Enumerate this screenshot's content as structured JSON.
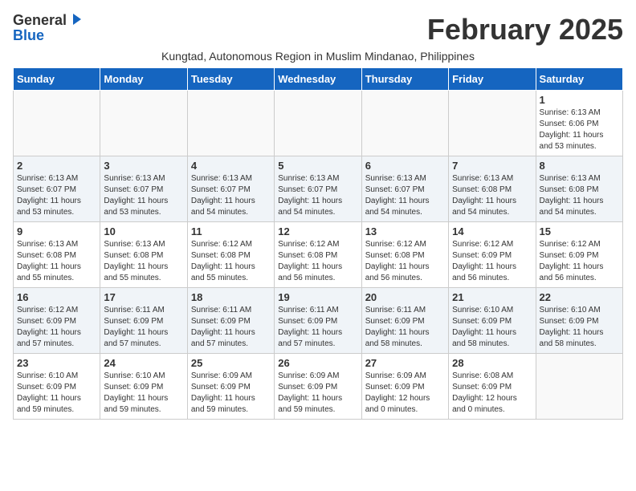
{
  "header": {
    "logo_top": "General",
    "logo_bottom": "Blue",
    "month": "February 2025",
    "location": "Kungtad, Autonomous Region in Muslim Mindanao, Philippines"
  },
  "weekdays": [
    "Sunday",
    "Monday",
    "Tuesday",
    "Wednesday",
    "Thursday",
    "Friday",
    "Saturday"
  ],
  "weeks": [
    {
      "shaded": false,
      "days": [
        {
          "num": "",
          "info": ""
        },
        {
          "num": "",
          "info": ""
        },
        {
          "num": "",
          "info": ""
        },
        {
          "num": "",
          "info": ""
        },
        {
          "num": "",
          "info": ""
        },
        {
          "num": "",
          "info": ""
        },
        {
          "num": "1",
          "info": "Sunrise: 6:13 AM\nSunset: 6:06 PM\nDaylight: 11 hours\nand 53 minutes."
        }
      ]
    },
    {
      "shaded": true,
      "days": [
        {
          "num": "2",
          "info": "Sunrise: 6:13 AM\nSunset: 6:07 PM\nDaylight: 11 hours\nand 53 minutes."
        },
        {
          "num": "3",
          "info": "Sunrise: 6:13 AM\nSunset: 6:07 PM\nDaylight: 11 hours\nand 53 minutes."
        },
        {
          "num": "4",
          "info": "Sunrise: 6:13 AM\nSunset: 6:07 PM\nDaylight: 11 hours\nand 54 minutes."
        },
        {
          "num": "5",
          "info": "Sunrise: 6:13 AM\nSunset: 6:07 PM\nDaylight: 11 hours\nand 54 minutes."
        },
        {
          "num": "6",
          "info": "Sunrise: 6:13 AM\nSunset: 6:07 PM\nDaylight: 11 hours\nand 54 minutes."
        },
        {
          "num": "7",
          "info": "Sunrise: 6:13 AM\nSunset: 6:08 PM\nDaylight: 11 hours\nand 54 minutes."
        },
        {
          "num": "8",
          "info": "Sunrise: 6:13 AM\nSunset: 6:08 PM\nDaylight: 11 hours\nand 54 minutes."
        }
      ]
    },
    {
      "shaded": false,
      "days": [
        {
          "num": "9",
          "info": "Sunrise: 6:13 AM\nSunset: 6:08 PM\nDaylight: 11 hours\nand 55 minutes."
        },
        {
          "num": "10",
          "info": "Sunrise: 6:13 AM\nSunset: 6:08 PM\nDaylight: 11 hours\nand 55 minutes."
        },
        {
          "num": "11",
          "info": "Sunrise: 6:12 AM\nSunset: 6:08 PM\nDaylight: 11 hours\nand 55 minutes."
        },
        {
          "num": "12",
          "info": "Sunrise: 6:12 AM\nSunset: 6:08 PM\nDaylight: 11 hours\nand 56 minutes."
        },
        {
          "num": "13",
          "info": "Sunrise: 6:12 AM\nSunset: 6:08 PM\nDaylight: 11 hours\nand 56 minutes."
        },
        {
          "num": "14",
          "info": "Sunrise: 6:12 AM\nSunset: 6:09 PM\nDaylight: 11 hours\nand 56 minutes."
        },
        {
          "num": "15",
          "info": "Sunrise: 6:12 AM\nSunset: 6:09 PM\nDaylight: 11 hours\nand 56 minutes."
        }
      ]
    },
    {
      "shaded": true,
      "days": [
        {
          "num": "16",
          "info": "Sunrise: 6:12 AM\nSunset: 6:09 PM\nDaylight: 11 hours\nand 57 minutes."
        },
        {
          "num": "17",
          "info": "Sunrise: 6:11 AM\nSunset: 6:09 PM\nDaylight: 11 hours\nand 57 minutes."
        },
        {
          "num": "18",
          "info": "Sunrise: 6:11 AM\nSunset: 6:09 PM\nDaylight: 11 hours\nand 57 minutes."
        },
        {
          "num": "19",
          "info": "Sunrise: 6:11 AM\nSunset: 6:09 PM\nDaylight: 11 hours\nand 57 minutes."
        },
        {
          "num": "20",
          "info": "Sunrise: 6:11 AM\nSunset: 6:09 PM\nDaylight: 11 hours\nand 58 minutes."
        },
        {
          "num": "21",
          "info": "Sunrise: 6:10 AM\nSunset: 6:09 PM\nDaylight: 11 hours\nand 58 minutes."
        },
        {
          "num": "22",
          "info": "Sunrise: 6:10 AM\nSunset: 6:09 PM\nDaylight: 11 hours\nand 58 minutes."
        }
      ]
    },
    {
      "shaded": false,
      "days": [
        {
          "num": "23",
          "info": "Sunrise: 6:10 AM\nSunset: 6:09 PM\nDaylight: 11 hours\nand 59 minutes."
        },
        {
          "num": "24",
          "info": "Sunrise: 6:10 AM\nSunset: 6:09 PM\nDaylight: 11 hours\nand 59 minutes."
        },
        {
          "num": "25",
          "info": "Sunrise: 6:09 AM\nSunset: 6:09 PM\nDaylight: 11 hours\nand 59 minutes."
        },
        {
          "num": "26",
          "info": "Sunrise: 6:09 AM\nSunset: 6:09 PM\nDaylight: 11 hours\nand 59 minutes."
        },
        {
          "num": "27",
          "info": "Sunrise: 6:09 AM\nSunset: 6:09 PM\nDaylight: 12 hours\nand 0 minutes."
        },
        {
          "num": "28",
          "info": "Sunrise: 6:08 AM\nSunset: 6:09 PM\nDaylight: 12 hours\nand 0 minutes."
        },
        {
          "num": "",
          "info": ""
        }
      ]
    }
  ]
}
